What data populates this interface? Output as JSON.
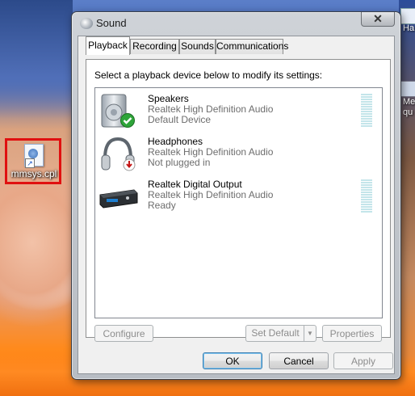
{
  "desktop": {
    "highlighted_icon_label": "mmsys.cpl",
    "right_icon1_label": "Ha",
    "right_icon2_label": "Me\nqu"
  },
  "window": {
    "title": "Sound",
    "close_glyph": "✕"
  },
  "tabs": [
    {
      "label": "Playback",
      "active": true
    },
    {
      "label": "Recording",
      "active": false
    },
    {
      "label": "Sounds",
      "active": false
    },
    {
      "label": "Communications",
      "active": false
    }
  ],
  "playback": {
    "instruction": "Select a playback device below to modify its settings:",
    "devices": [
      {
        "name": "Speakers",
        "driver": "Realtek High Definition Audio",
        "status": "Default Device",
        "icon": "speaker-icon",
        "badge": "green-check-icon",
        "meter": true
      },
      {
        "name": "Headphones",
        "driver": "Realtek High Definition Audio",
        "status": "Not plugged in",
        "icon": "headphones-icon",
        "badge": "red-down-arrow-icon",
        "meter": false
      },
      {
        "name": "Realtek Digital Output",
        "driver": "Realtek High Definition Audio",
        "status": "Ready",
        "icon": "digital-output-icon",
        "badge": "",
        "meter": true
      }
    ],
    "buttons": {
      "configure": "Configure",
      "set_default": "Set Default",
      "properties": "Properties"
    }
  },
  "footer": {
    "ok": "OK",
    "cancel": "Cancel",
    "apply": "Apply"
  }
}
